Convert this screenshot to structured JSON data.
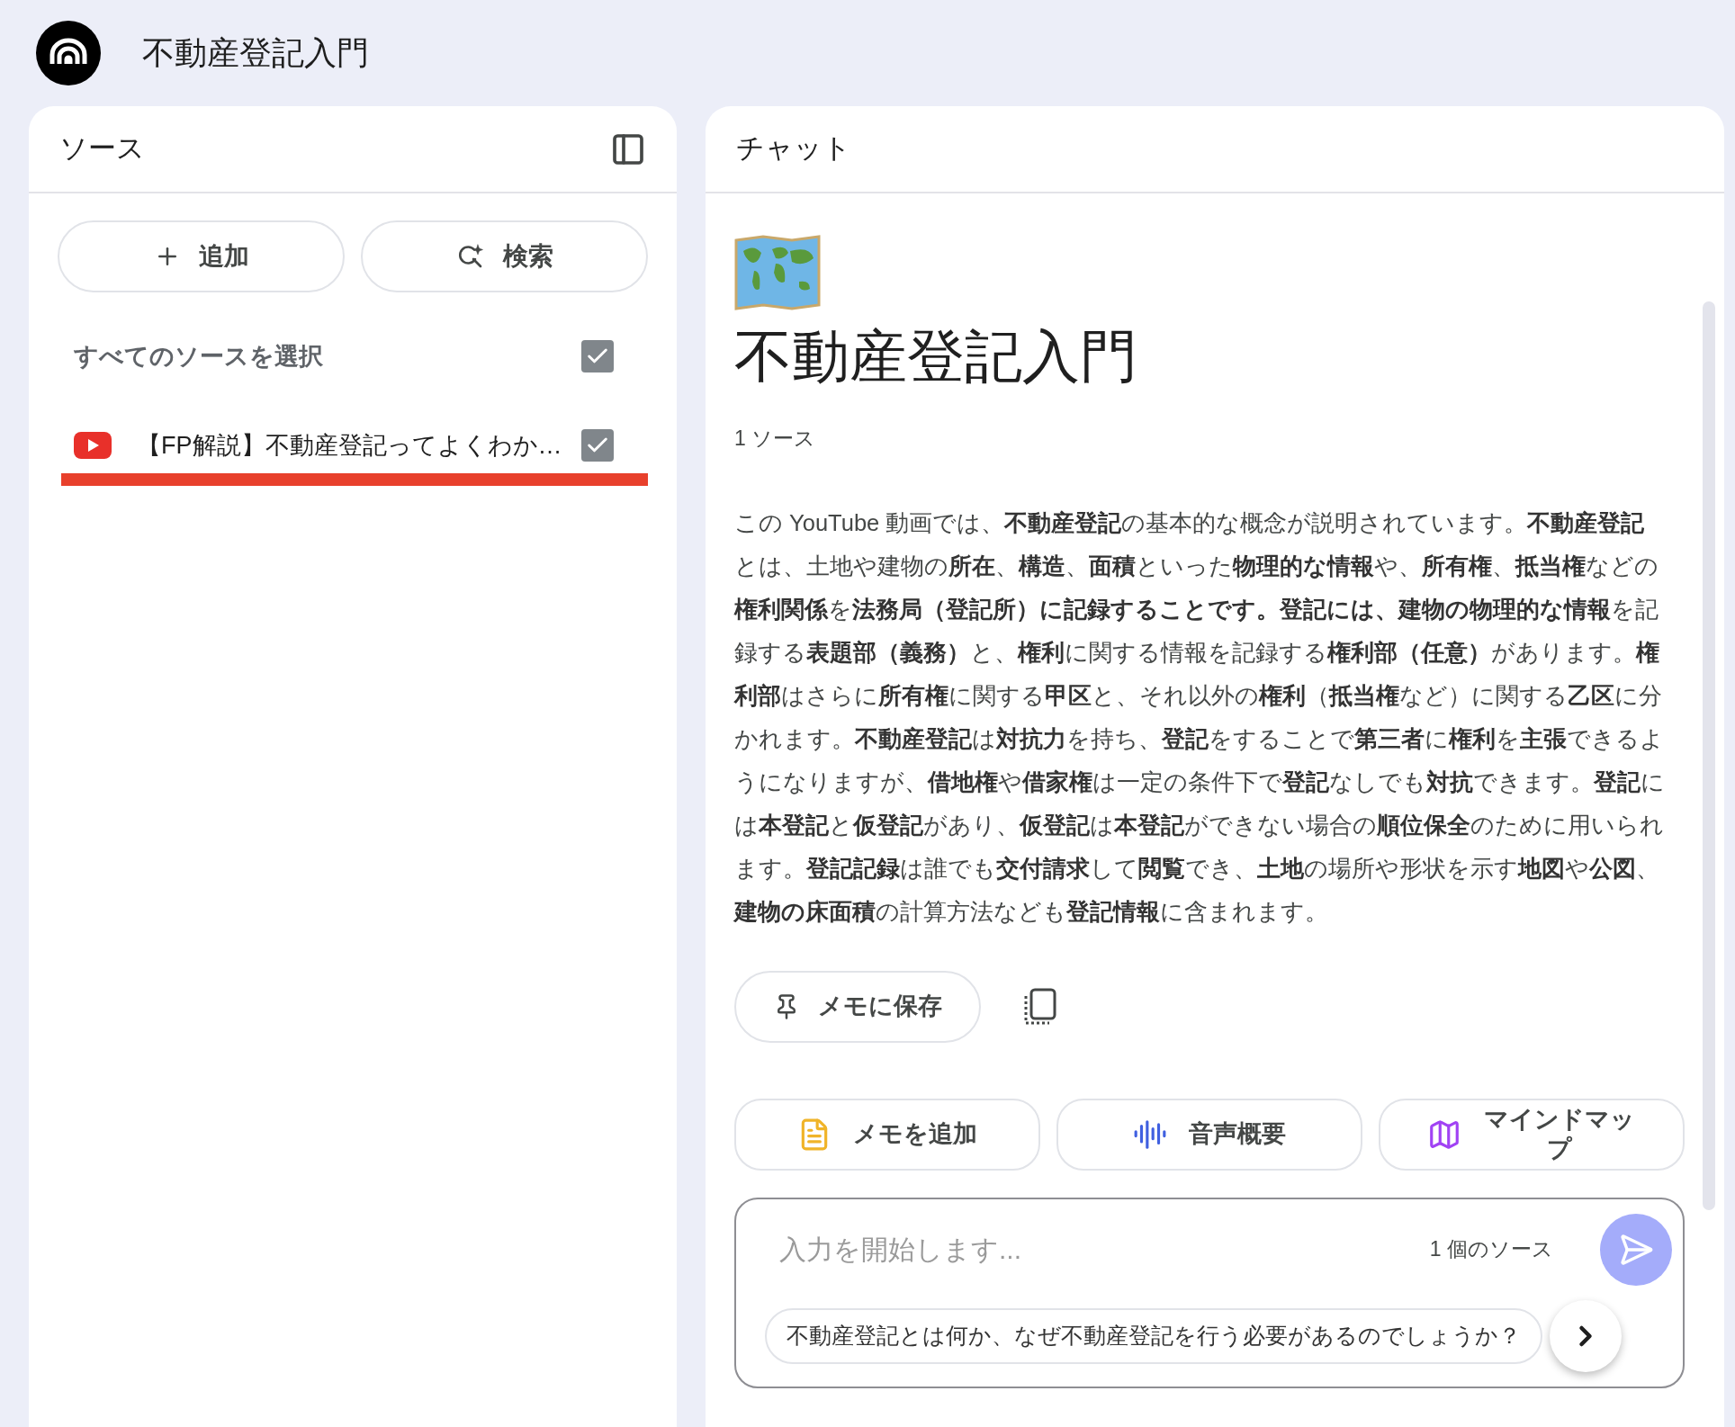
{
  "app": {
    "title": "不動産登記入門"
  },
  "sources_panel": {
    "title": "ソース",
    "buttons": [
      {
        "label": "追加",
        "kind": "add"
      },
      {
        "label": "検索",
        "kind": "search"
      }
    ],
    "select_all": {
      "label": "すべてのソースを選択",
      "checked": true
    },
    "sources": [
      {
        "title": "【FP解説】不動産登記ってよくわか…",
        "checked": true,
        "selected": true
      }
    ]
  },
  "chat_panel": {
    "title": "チャット",
    "notebook_title": "不動産登記入門",
    "source_count": "1 ソース",
    "summary": "この YouTube 動画では、**不動産登記**の基本的な概念が説明されています。**不動産登記**とは、土地や建物の**所在**、**構造**、**面積**といった**物理的な情報**や、**所有権**、**抵当権**などの**権利関係**を**法務局（登記所）に記録することです。登記には、建物の物理的な情報**を記録する**表題部（義務）**と、**権利**に関する情報を記録する**権利部（任意）**があります。**権利部**はさらに**所有権**に関する**甲区**と、それ以外の**権利**（**抵当権**など）に関する**乙区**に分かれます。**不動産登記**は**対抗力**を持ち、**登記**をすることで**第三者**に**権利**を**主張**できるようになりますが、**借地権**や**借家権**は一定の条件下で**登記**なしでも**対抗**できます。**登記**には**本登記**と**仮登記**があり、**仮登記**は**本登記**ができない場合の**順位保全**のために用いられます。**登記記録**は誰でも**交付請求**して**閲覧**でき、**土地**の場所や形状を示す**地図**や**公図**、**建物の床面積**の計算方法なども**登記情報**に含まれます。",
    "save_button": "メモに保存",
    "actions": [
      {
        "label": "メモを追加",
        "kind": "note"
      },
      {
        "label": "音声概要",
        "kind": "audio"
      },
      {
        "label": "マインドマップ",
        "kind": "mindmap"
      }
    ],
    "input": {
      "placeholder": "入力を開始します...",
      "source_count": "1 個のソース",
      "suggestion": "不動産登記とは何か、なぜ不動産登記を行う必要があるのでしょうか？"
    }
  }
}
